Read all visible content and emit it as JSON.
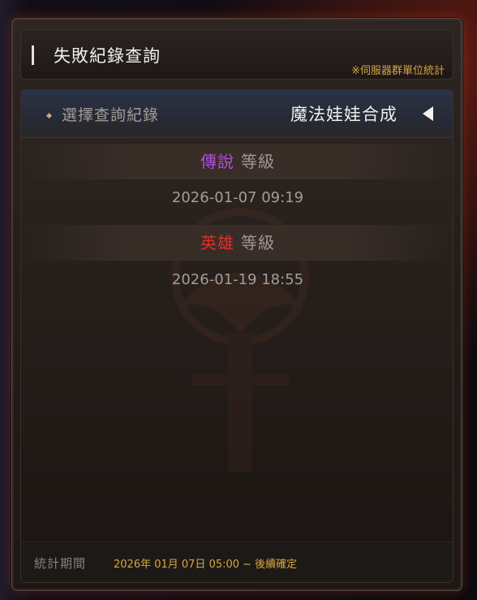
{
  "header": {
    "title": "失敗紀錄查詢",
    "note": "※伺服器群單位統計"
  },
  "selector": {
    "label": "選擇查詢紀錄",
    "value": "魔法娃娃合成",
    "arrow_icon": "triangle-left-icon"
  },
  "records": [
    {
      "grade": "傳說",
      "grade_color": "#b04ee0",
      "suffix": "等級",
      "date": "2026-01-07 09:19"
    },
    {
      "grade": "英雄",
      "grade_color": "#e0302c",
      "suffix": "等級",
      "date": "2026-01-19 18:55"
    }
  ],
  "footer": {
    "label": "統計期間",
    "value": "2026年 01月 07日 05:00 ~ 後續確定"
  },
  "colors": {
    "accent_gold": "#d9a43c",
    "panel_border_glow": "#c8461e"
  }
}
